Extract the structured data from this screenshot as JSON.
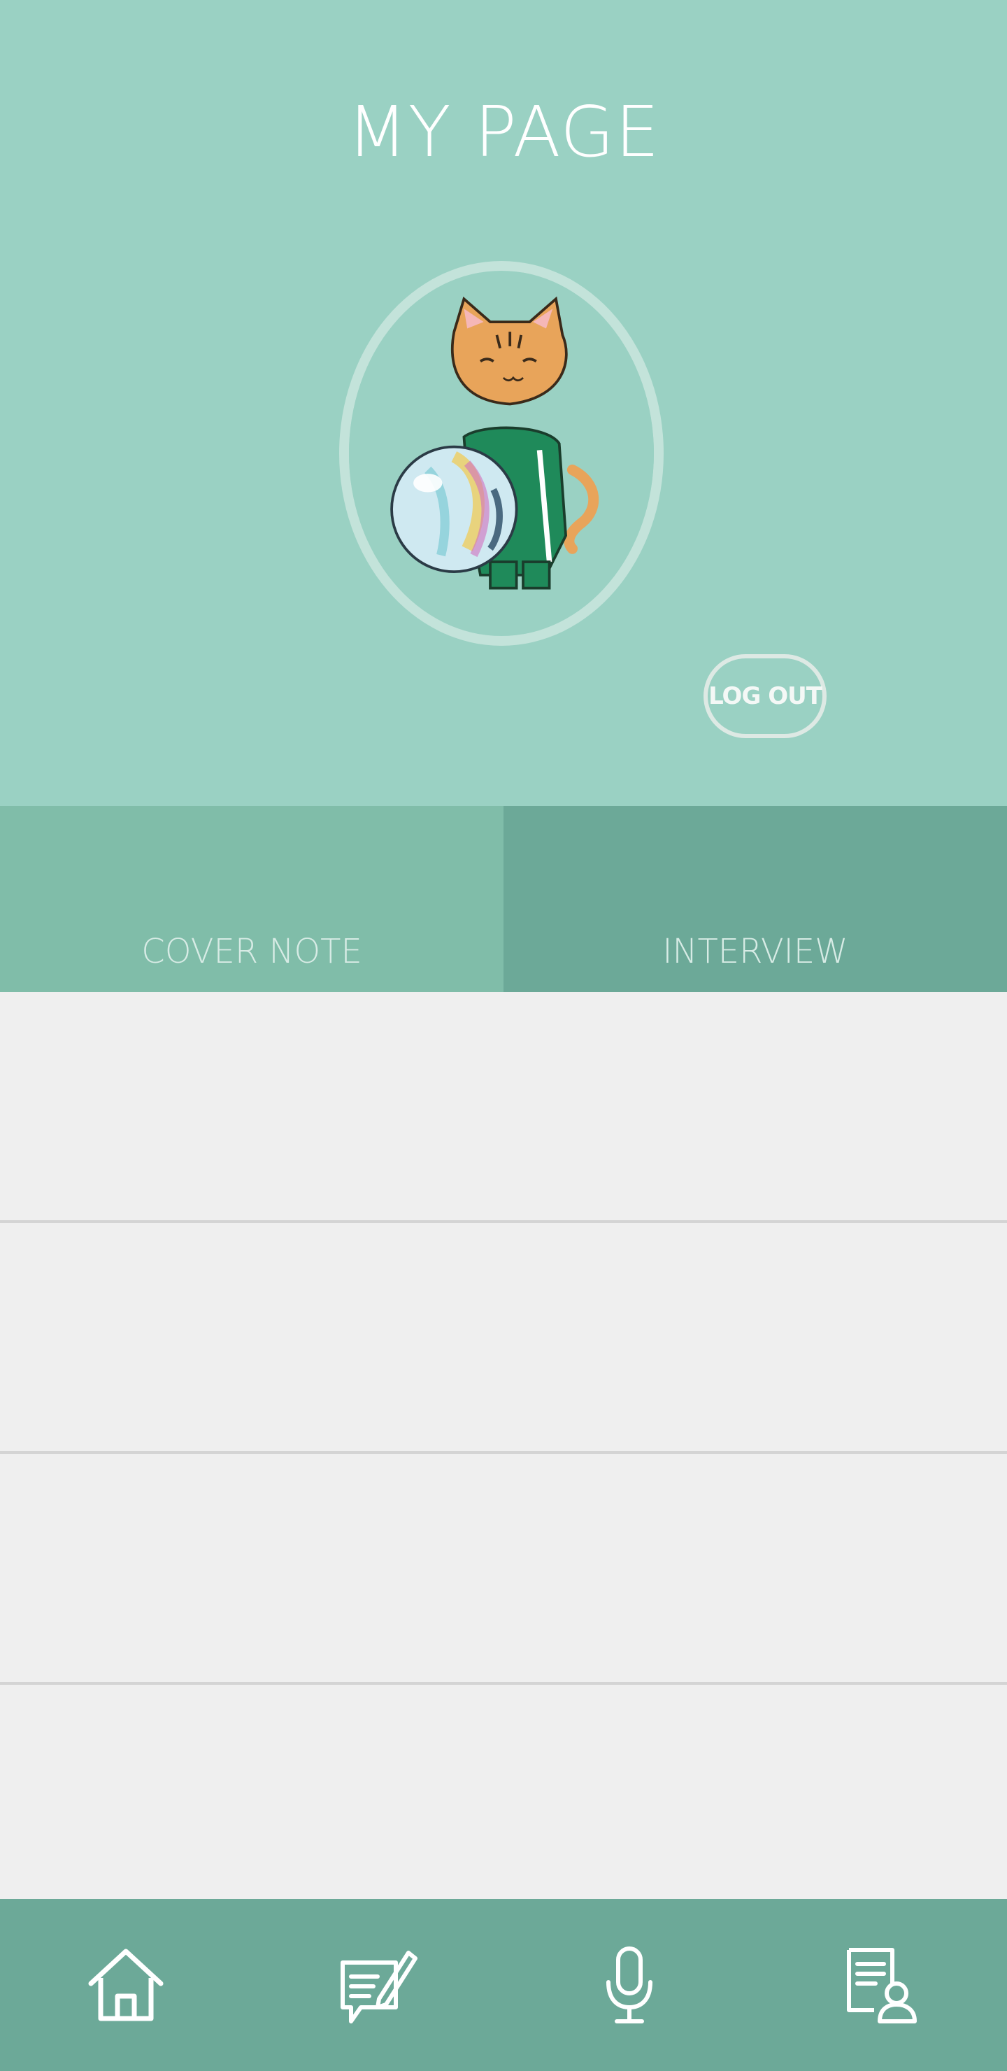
{
  "header": {
    "title": "MY PAGE",
    "logout_label": "LOG OUT"
  },
  "tabs": [
    {
      "label": "COVER NOTE"
    },
    {
      "label": "INTERVIEW"
    }
  ],
  "list": {
    "items": [
      "",
      "",
      "",
      ""
    ]
  },
  "bottom_nav": [
    {
      "icon": "home-icon"
    },
    {
      "icon": "write-note-icon"
    },
    {
      "icon": "microphone-icon"
    },
    {
      "icon": "profile-document-icon"
    }
  ],
  "colors": {
    "header_bg": "#9ad1c3",
    "tab_cover_bg": "#80bda9",
    "tab_interview_bg": "#6ca998",
    "nav_bg": "#6ca998",
    "list_bg": "#efefef"
  }
}
